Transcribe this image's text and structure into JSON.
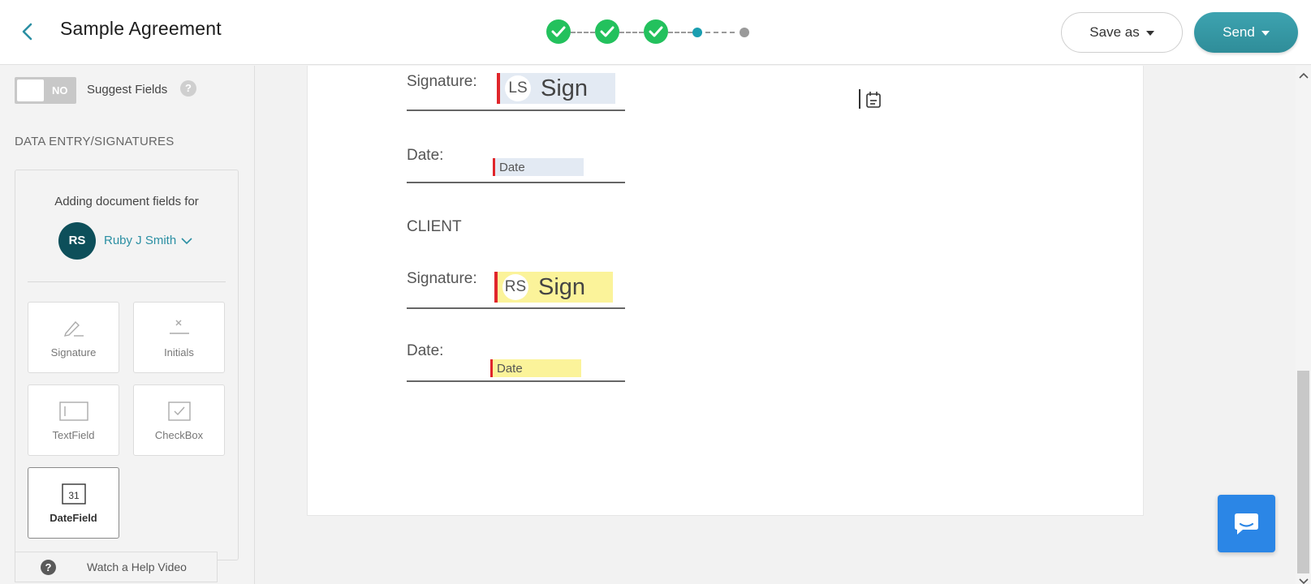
{
  "header": {
    "title": "Sample Agreement",
    "save_label": "Save as",
    "send_label": "Send",
    "steps": [
      "done",
      "done",
      "done",
      "current",
      "pending"
    ]
  },
  "sidebar": {
    "toggle_label": "NO",
    "suggest_label": "Suggest Fields",
    "help_glyph": "?",
    "section_title": "DATA ENTRY/SIGNATURES",
    "adding_label": "Adding document fields for",
    "avatar_initials": "RS",
    "recipient_name": "Ruby J Smith",
    "fields": [
      {
        "label": "Signature",
        "icon": "pen-icon"
      },
      {
        "label": "Initials",
        "icon": "initials-icon"
      },
      {
        "label": "TextField",
        "icon": "textfield-icon"
      },
      {
        "label": "CheckBox",
        "icon": "checkbox-icon"
      },
      {
        "label": "DateField",
        "icon": "calendar-icon",
        "day": "31"
      }
    ],
    "help_video_label": "Watch a Help Video"
  },
  "document": {
    "sender": {
      "signature_label": "Signature:",
      "signature_initials": "LS",
      "signature_text": "Sign",
      "date_label": "Date:",
      "date_text": "Date"
    },
    "client_heading": "CLIENT",
    "client": {
      "signature_label": "Signature:",
      "signature_initials": "RS",
      "signature_text": "Sign",
      "date_label": "Date:",
      "date_text": "Date"
    }
  },
  "colors": {
    "accent": "#2b8fa3",
    "step_done": "#23c15d",
    "step_current": "#1a9eb0",
    "step_pending": "#9a9a9a",
    "send_button": "#3399a5",
    "field_required": "#e0262b",
    "sender_field": "#e3eaf3",
    "client_field": "#fbf39a",
    "chat_button": "#2b86e6"
  }
}
